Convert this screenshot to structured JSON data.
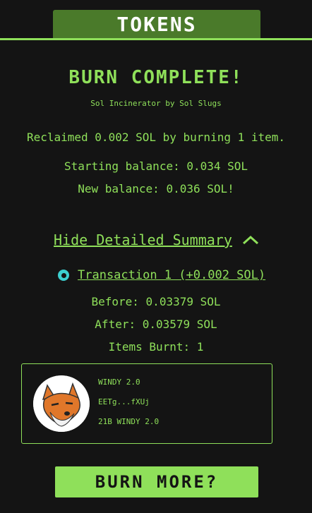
{
  "header": {
    "tab_label": "TOKENS"
  },
  "result": {
    "heading": "BURN COMPLETE!",
    "subtitle": "Sol Incinerator by Sol Slugs",
    "reclaimed": "Reclaimed 0.002 SOL by burning 1 item.",
    "starting_balance": "Starting balance: 0.034 SOL",
    "new_balance": "New balance: 0.036 SOL!"
  },
  "summary": {
    "toggle_label": "Hide Detailed Summary",
    "transaction_label": "Transaction 1 (+0.002 SOL)",
    "before": "Before: 0.03379 SOL",
    "after": "After: 0.03579 SOL",
    "items_burnt": "Items Burnt: 1"
  },
  "token": {
    "name": "WINDY 2.0",
    "address": "EETg...fXUj",
    "amount": "21B WINDY 2.0"
  },
  "actions": {
    "burn_more_label": "BURN MORE?"
  },
  "colors": {
    "accent": "#8fe05a",
    "background": "#141414",
    "tab": "#4a7a2a",
    "tx_icon": "#3ccfcf"
  }
}
